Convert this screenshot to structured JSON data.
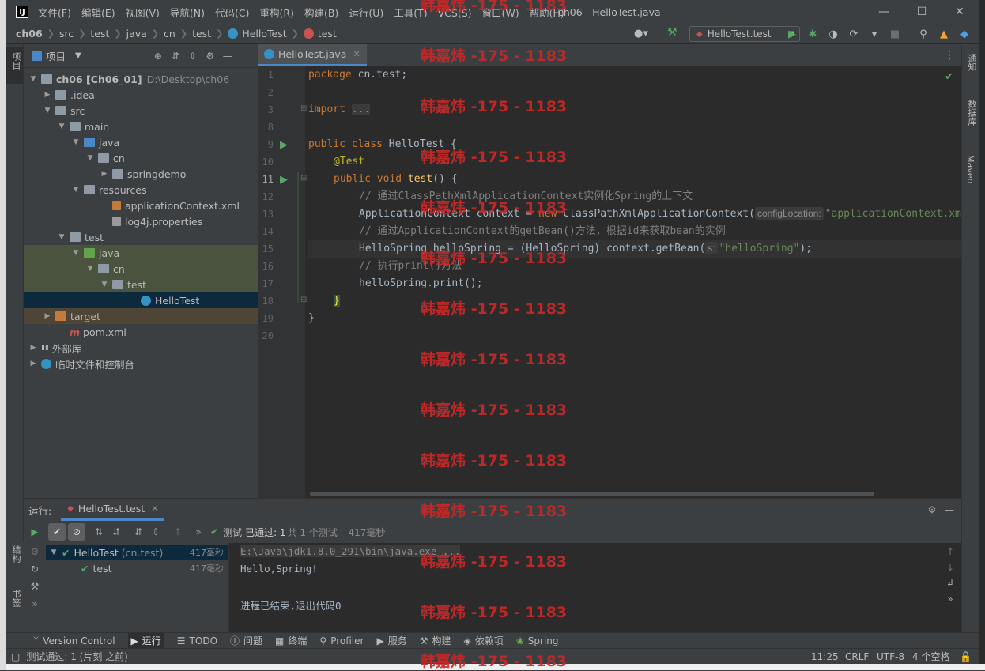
{
  "window": {
    "logo": "IJ",
    "title": "ch06 - HelloTest.java",
    "menu": [
      "文件(F)",
      "编辑(E)",
      "视图(V)",
      "导航(N)",
      "代码(C)",
      "重构(R)",
      "构建(B)",
      "运行(U)",
      "工具(T)",
      "VCS(S)",
      "窗口(W)",
      "帮助(H)"
    ]
  },
  "breadcrumb": [
    "ch06",
    "src",
    "test",
    "java",
    "cn",
    "test",
    "HelloTest",
    "test"
  ],
  "run_config": "HelloTest.test",
  "left_tool_label": "项目",
  "right_tools": [
    "通知",
    "数据库",
    "Maven"
  ],
  "project": {
    "header": "项目",
    "tree": [
      {
        "label": "ch06 [Ch06_01]",
        "extra": "D:\\Desktop\\ch06",
        "indent": 0,
        "open": true,
        "icon": "folder"
      },
      {
        "label": ".idea",
        "indent": 1,
        "open": false,
        "icon": "folder"
      },
      {
        "label": "src",
        "indent": 1,
        "open": true,
        "icon": "folder"
      },
      {
        "label": "main",
        "indent": 2,
        "open": true,
        "icon": "folder"
      },
      {
        "label": "java",
        "indent": 3,
        "open": true,
        "icon": "folderblue"
      },
      {
        "label": "cn",
        "indent": 4,
        "open": true,
        "icon": "folder"
      },
      {
        "label": "springdemo",
        "indent": 5,
        "open": false,
        "icon": "folder"
      },
      {
        "label": "resources",
        "indent": 3,
        "open": true,
        "icon": "folder"
      },
      {
        "label": "applicationContext.xml",
        "indent": 5,
        "icon": "xml"
      },
      {
        "label": "log4j.properties",
        "indent": 5,
        "icon": "props"
      },
      {
        "label": "test",
        "indent": 2,
        "open": true,
        "icon": "folder"
      },
      {
        "label": "java",
        "indent": 3,
        "open": true,
        "icon": "foldergreen"
      },
      {
        "label": "cn",
        "indent": 4,
        "open": true,
        "icon": "folder"
      },
      {
        "label": "test",
        "indent": 5,
        "open": true,
        "icon": "folder"
      },
      {
        "label": "HelloTest",
        "indent": 7,
        "icon": "class"
      },
      {
        "label": "target",
        "indent": 1,
        "open": false,
        "icon": "folderorange"
      },
      {
        "label": "pom.xml",
        "indent": 2,
        "icon": "maven"
      },
      {
        "label": "外部库",
        "indent": 0,
        "open": false,
        "icon": "lib"
      },
      {
        "label": "临时文件和控制台",
        "indent": 0,
        "open": false,
        "icon": "scratch"
      }
    ]
  },
  "editor": {
    "tab": "HelloTest.java",
    "line_numbers": [
      "1",
      "2",
      "3",
      "8",
      "9",
      "10",
      "11",
      "12",
      "13",
      "14",
      "15",
      "16",
      "17",
      "18",
      "19",
      "20"
    ],
    "lines": {
      "l1a": "package ",
      "l1b": "cn.test;",
      "l3a": "import ",
      "l3b": "...",
      "l9a": "public class ",
      "l9b": "HelloTest {",
      "l10": "@Test",
      "l11a": "public void ",
      "l11b": "test",
      "l11c": "() {",
      "l12": "// 通过ClassPathXmlApplicationContext实例化Spring的上下文",
      "l13a": "ApplicationContext context = ",
      "l13b": "new ",
      "l13c": "ClassPathXmlApplicationContext(",
      "l13hint": "configLocation:",
      "l13d": "\"applicationContext.xml\");",
      "l14": "// 通过ApplicationContext的getBean()方法，根据id来获取bean的实例",
      "l15a": "HelloSpring helloSpring = (HelloSpring) context.getBean(",
      "l15hint": "s:",
      "l15b": "\"helloSpring\"",
      "l15c": ");",
      "l16": "// 执行print()方法",
      "l17": "helloSpring.print();",
      "l18": "}",
      "l19": "}"
    }
  },
  "run": {
    "label": "运行:",
    "tab": "HelloTest.test",
    "status_prefix": "测试",
    "status_passed": "已通过: 1",
    "status_rest": "共 1 个测试 – 417毫秒",
    "tests": [
      {
        "name": "HelloTest",
        "pkg": "(cn.test)",
        "time": "417毫秒"
      },
      {
        "name": "test",
        "time": "417毫秒"
      }
    ],
    "console": [
      "E:\\Java\\jdk1.8.0_291\\bin\\java.exe ...",
      "Hello,Spring!",
      "",
      "进程已结束,退出代码0"
    ],
    "side_labels": [
      "结构",
      "书签"
    ]
  },
  "bottom_tabs": [
    "Version Control",
    "运行",
    "TODO",
    "问题",
    "终端",
    "Profiler",
    "服务",
    "构建",
    "依赖项",
    "Spring"
  ],
  "statusbar": {
    "message": "测试通过: 1 (片刻 之前)",
    "position": "11:25",
    "line_sep": "CRLF",
    "encoding": "UTF-8",
    "indent": "4 个空格"
  },
  "watermark": "韩嘉炜 -175 - 1183"
}
